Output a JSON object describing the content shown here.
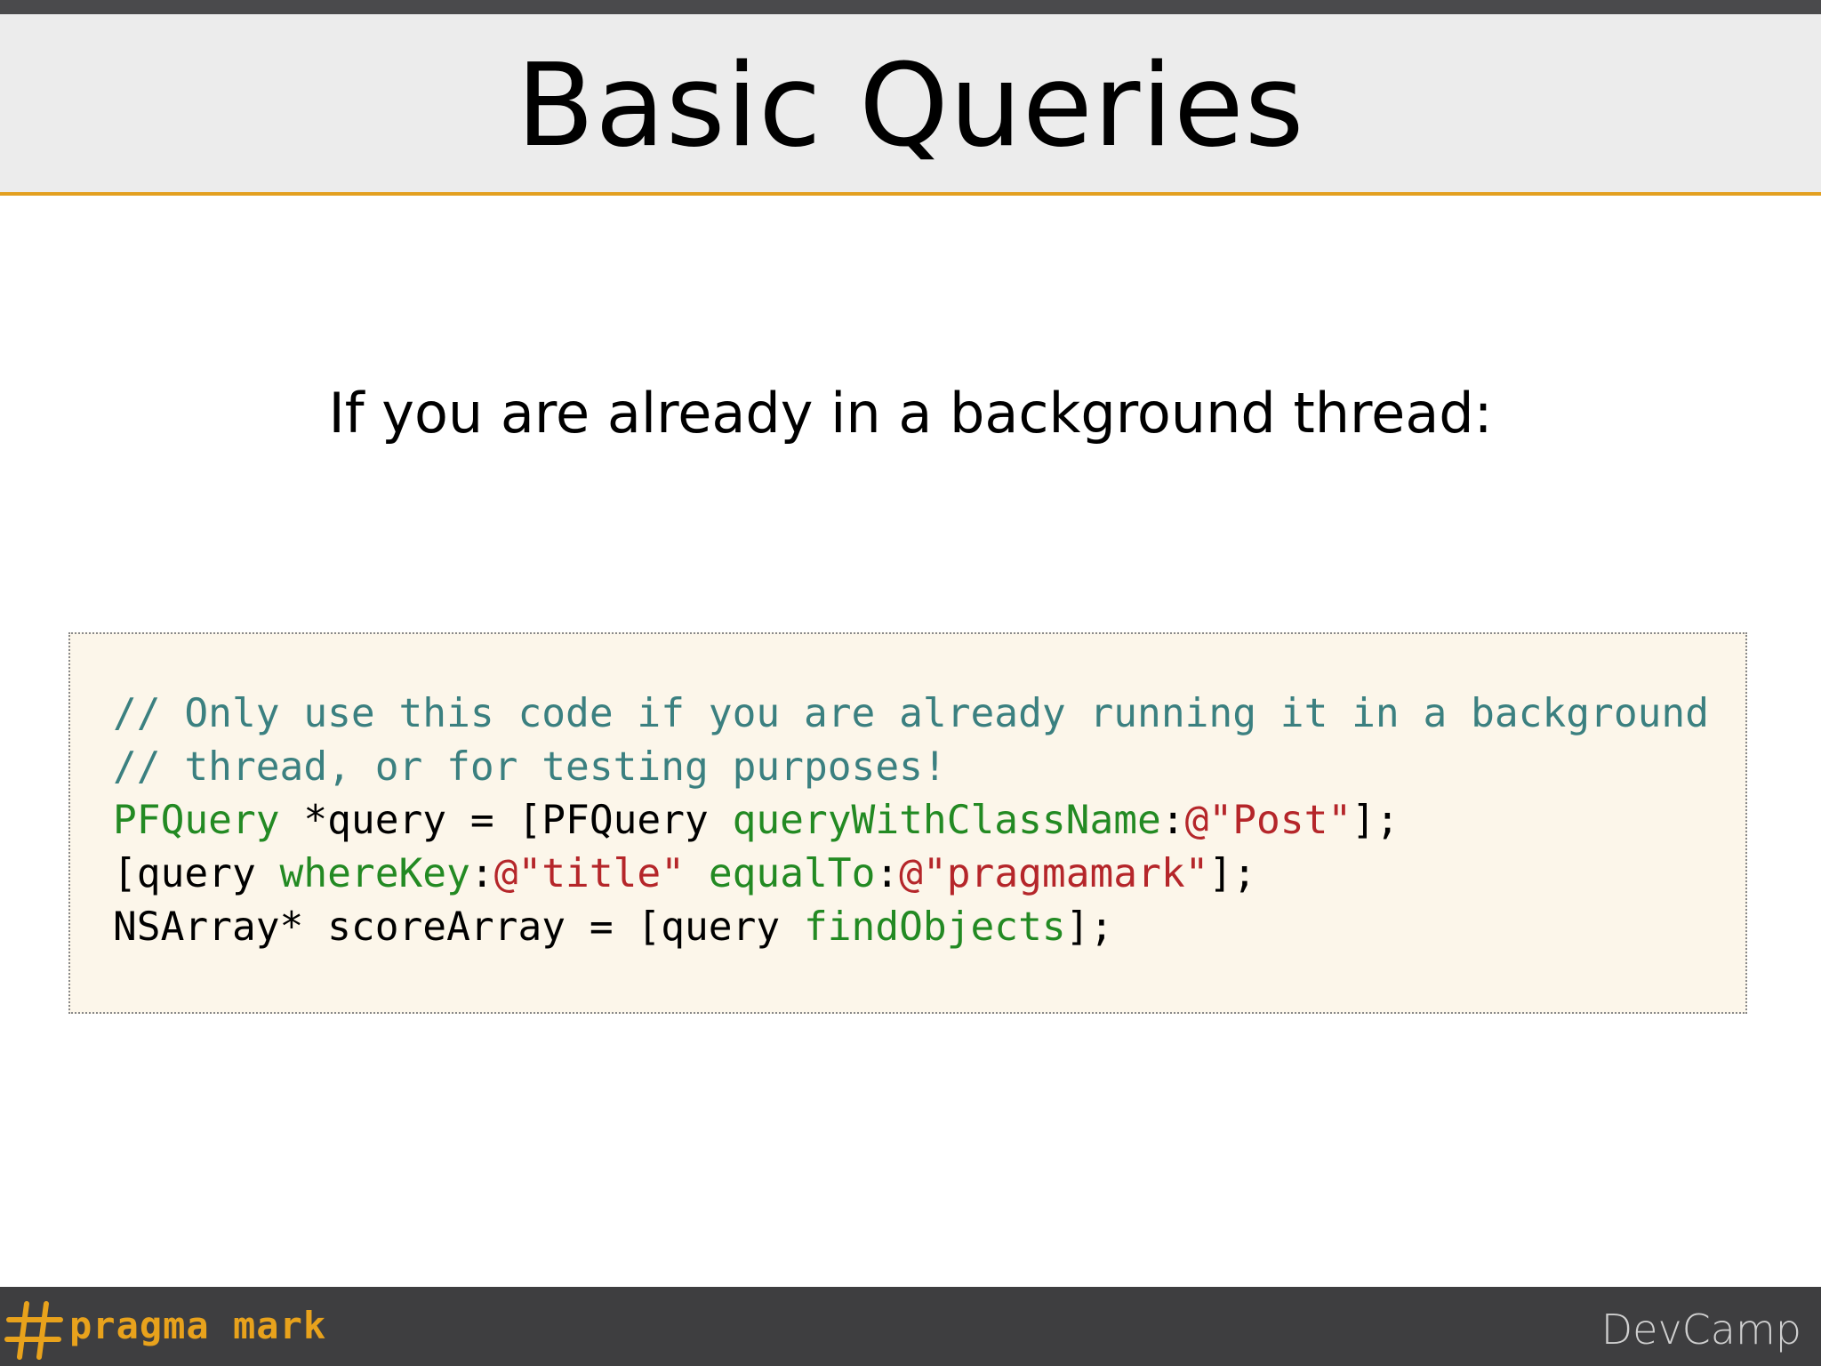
{
  "slide": {
    "title": "Basic Queries",
    "subtitle": "If you are already in a background thread:"
  },
  "code": {
    "lines": [
      [
        {
          "type": "comment",
          "text": "// Only use this code if you are already running it in a background"
        }
      ],
      [
        {
          "type": "comment",
          "text": "// thread, or for testing purposes!"
        }
      ],
      [
        {
          "type": "type",
          "text": "PFQuery"
        },
        {
          "type": "plain",
          "text": " *query = [PFQuery "
        },
        {
          "type": "method",
          "text": "queryWithClassName"
        },
        {
          "type": "plain",
          "text": ":"
        },
        {
          "type": "string",
          "text": "@\"Post\""
        },
        {
          "type": "plain",
          "text": "];"
        }
      ],
      [
        {
          "type": "plain",
          "text": "[query "
        },
        {
          "type": "method",
          "text": "whereKey"
        },
        {
          "type": "plain",
          "text": ":"
        },
        {
          "type": "string",
          "text": "@\"title\""
        },
        {
          "type": "plain",
          "text": " "
        },
        {
          "type": "method",
          "text": "equalTo"
        },
        {
          "type": "plain",
          "text": ":"
        },
        {
          "type": "string",
          "text": "@\"pragmamark\""
        },
        {
          "type": "plain",
          "text": "];"
        }
      ],
      [
        {
          "type": "plain",
          "text": "NSArray* scoreArray = [query "
        },
        {
          "type": "method",
          "text": "findObjects"
        },
        {
          "type": "plain",
          "text": "];"
        }
      ]
    ]
  },
  "footer": {
    "brand_icon": "hash-icon",
    "brand_text": "pragma mark",
    "event_label": "DevCamp"
  },
  "colors": {
    "accent": "#e3a020",
    "comment": "#3b8080",
    "method": "#238a23",
    "string": "#b5262a",
    "code_background": "#fcf6ea",
    "footer_background": "#3e3e40"
  }
}
